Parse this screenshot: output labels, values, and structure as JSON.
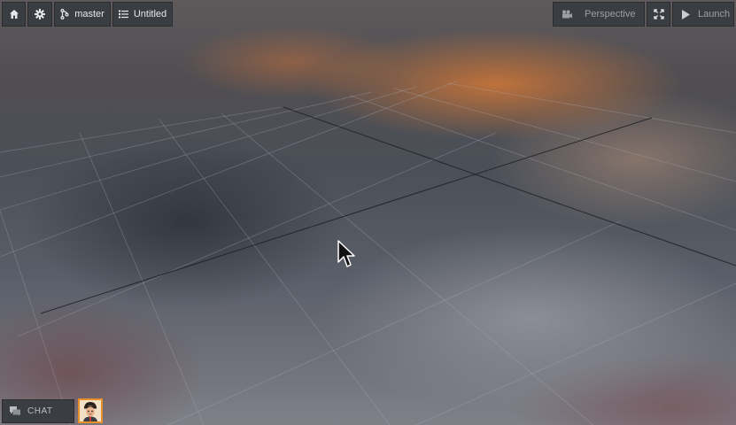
{
  "toolbar": {
    "home_icon": "home-icon",
    "settings_icon": "gear-icon",
    "branch": {
      "icon": "git-branch-icon",
      "label": "master"
    },
    "scene": {
      "icon": "list-icon",
      "label": "Untitled"
    },
    "camera": {
      "icon": "camera-icon",
      "label": "Perspective"
    },
    "fullscreen_icon": "fullscreen-icon",
    "launch": {
      "icon": "play-icon",
      "label": "Launch"
    }
  },
  "chat": {
    "icon": "chat-icon",
    "label": "CHAT"
  },
  "user": {
    "avatar": "user-avatar"
  },
  "colors": {
    "toolbar_bg": "#3a3d42",
    "avatar_border": "#e8902a",
    "grid_line": "#9aa0a8",
    "axis_line": "#1d1f22"
  }
}
